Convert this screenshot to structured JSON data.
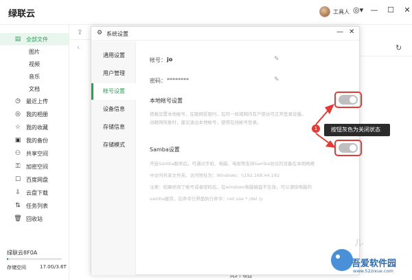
{
  "app": {
    "title": "绿联云"
  },
  "user": {
    "name": "工具人"
  },
  "window_controls": {
    "settings": "◎▾",
    "min": "—",
    "max": "☐",
    "close": "✕"
  },
  "sidebar": {
    "items": [
      {
        "label": "全部文件",
        "icon": "document-icon",
        "active": true
      },
      {
        "label": "图片",
        "sub": true
      },
      {
        "label": "视频",
        "sub": true
      },
      {
        "label": "音乐",
        "sub": true
      },
      {
        "label": "文档",
        "sub": true
      },
      {
        "label": "最近上传",
        "icon": "clock-icon"
      },
      {
        "label": "我的相册",
        "icon": "album-icon"
      },
      {
        "label": "我的收藏",
        "icon": "star-icon"
      },
      {
        "label": "我的备份",
        "icon": "backup-icon"
      },
      {
        "label": "共享空间",
        "icon": "users-icon"
      },
      {
        "label": "加密空间",
        "icon": "lock-icon"
      },
      {
        "label": "百度网盘",
        "icon": "cloud-drive-icon"
      },
      {
        "label": "云盘下载",
        "icon": "download-icon"
      },
      {
        "label": "任务列表",
        "icon": "transfer-icon"
      },
      {
        "label": "回收站",
        "icon": "trash-icon"
      }
    ],
    "device_name": "绿联云8F0A",
    "storage_label": "存储空间",
    "storage_value": "17.0G/3.6T",
    "storage_fraction": 0.005
  },
  "dialog": {
    "title": "系统设置",
    "nav": [
      {
        "label": "通用设置"
      },
      {
        "label": "用户管理"
      },
      {
        "label": "帐号设置",
        "active": true
      },
      {
        "label": "设备信息"
      },
      {
        "label": "存储信息"
      },
      {
        "label": "存储模式"
      }
    ],
    "account_label": "帐号：",
    "account_value": "jo",
    "password_label": "密码：",
    "password_value": "********",
    "local_title": "本地帐号设置",
    "local_desc_1": "搭载设置本地帐号，在联网受限时，在同一局域网内有户使访可正常登录设备。",
    "local_desc_2": "当联网恢复时，建议退出本地帐号，使用在线帐号登录。",
    "samba_title": "Samba设置",
    "samba_desc_1": "开启Samba服务后，可通过手机、电脑、电视等支持Samba协议的设备在本地网络",
    "samba_desc_2": "中访问共享文件夹。访问地址为：Windows：\\\\192.168.44.192",
    "samba_desc_3": "注意：如果修改了帐号或者密码后，在windows电脑磁盘不生效，可以请除电脑的",
    "samba_desc_4": "samba缓存，在命令行界面执行命令：net use * /del /y",
    "local_toggle_on": false,
    "samba_toggle_on": false
  },
  "annotation": {
    "badge": "1",
    "tooltip": "按钮灰色为关闭状态"
  },
  "footer": {
    "text": "共2个项目"
  },
  "watermark": {
    "line1": "吾爱软件园",
    "line2": "www.52zixue.com"
  },
  "colors": {
    "accent": "#2d9d56",
    "highlight_red": "#e53935"
  }
}
